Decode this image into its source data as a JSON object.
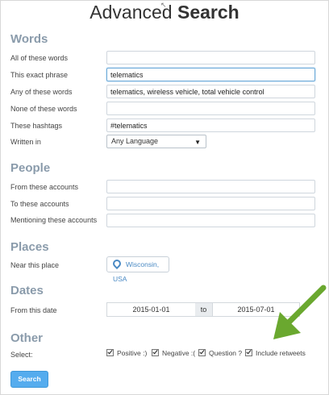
{
  "title": {
    "light": "Advanced ",
    "bold": "Search"
  },
  "words": {
    "heading": "Words",
    "all_label": "All of these words",
    "all_value": "",
    "exact_label": "This exact phrase",
    "exact_value": "telematics",
    "any_label": "Any of these words",
    "any_value": "telematics, wireless vehicle, total vehicle control",
    "none_label": "None of these words",
    "none_value": "",
    "hashtags_label": "These hashtags",
    "hashtags_value": "#telematics",
    "written_label": "Written in",
    "language_value": "Any Language"
  },
  "people": {
    "heading": "People",
    "from_label": "From these accounts",
    "to_label": "To these accounts",
    "mention_label": "Mentioning these accounts"
  },
  "places": {
    "heading": "Places",
    "near_label": "Near this place",
    "place_value": "Wisconsin, USA"
  },
  "dates": {
    "heading": "Dates",
    "from_label": "From this date",
    "from_value": "2015-01-01",
    "to_text": "to",
    "to_value": "2015-07-01"
  },
  "other": {
    "heading": "Other",
    "select_label": "Select:",
    "options": [
      "Positive :)",
      "Negative :(",
      "Question ?",
      "Include retweets"
    ]
  },
  "search_button": "Search",
  "icons": {
    "place": "map-pin-icon",
    "annotation": "green-arrow-icon",
    "dropdown": "dropdown-arrow-icon"
  },
  "colors": {
    "section_heading": "#8a9bab",
    "button": "#55acee",
    "arrow": "#6aa82f",
    "place_link": "#4a8ac4"
  }
}
